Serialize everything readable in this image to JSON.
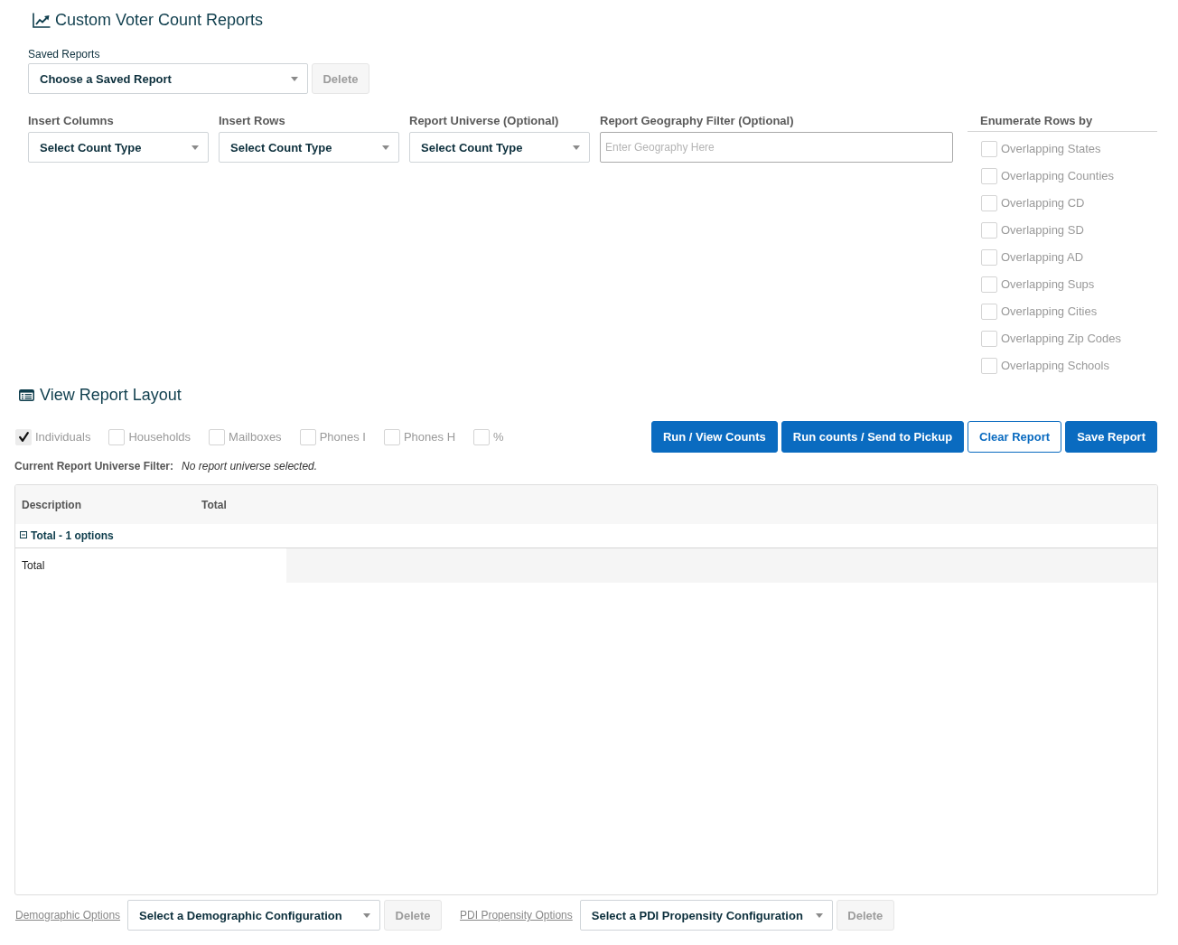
{
  "title": "Custom Voter Count Reports",
  "saved_reports": {
    "label": "Saved Reports",
    "select": "Choose a Saved Report",
    "delete": {
      "label": "Delete",
      "disabled": true
    }
  },
  "filters": [
    {
      "kind": "select",
      "label": "Insert Columns",
      "value": "Select Count Type"
    },
    {
      "kind": "select",
      "label": "Insert Rows",
      "value": "Select Count Type"
    },
    {
      "kind": "select",
      "label": "Report Universe (Optional)",
      "value": "Select Count Type"
    },
    {
      "kind": "text",
      "label": "Report Geography Filter (Optional)",
      "placeholder": "Enter Geography Here"
    }
  ],
  "enumerate": {
    "title": "Enumerate Rows by",
    "options": [
      {
        "label": "Overlapping States",
        "checked": false
      },
      {
        "label": "Overlapping Counties",
        "checked": false
      },
      {
        "label": "Overlapping CD",
        "checked": false
      },
      {
        "label": "Overlapping SD",
        "checked": false
      },
      {
        "label": "Overlapping AD",
        "checked": false
      },
      {
        "label": "Overlapping Sups",
        "checked": false
      },
      {
        "label": "Overlapping Cities",
        "checked": false
      },
      {
        "label": "Overlapping Zip Codes",
        "checked": false
      },
      {
        "label": "Overlapping Schools",
        "checked": false
      }
    ]
  },
  "layout": {
    "title": "View Report Layout",
    "count_types": [
      {
        "label": "Individuals",
        "checked": true
      },
      {
        "label": "Households",
        "checked": false
      },
      {
        "label": "Mailboxes",
        "checked": false
      },
      {
        "label": "Phones I",
        "checked": false
      },
      {
        "label": "Phones H",
        "checked": false
      },
      {
        "label": "%",
        "checked": false
      }
    ],
    "buttons": [
      {
        "kind": "primary",
        "label": "Run / View Counts"
      },
      {
        "kind": "primary",
        "label": "Run counts / Send to Pickup"
      },
      {
        "kind": "outline",
        "label": "Clear Report"
      },
      {
        "kind": "primary",
        "label": "Save Report"
      }
    ],
    "universe_filter": {
      "label": "Current Report Universe Filter:",
      "value": "No report universe selected."
    }
  },
  "table": {
    "columns": [
      "Description",
      "Total"
    ],
    "groups": [
      {
        "label": "Total - 1 options",
        "expanded": true,
        "rows": [
          {
            "label": "Total"
          }
        ]
      }
    ]
  },
  "options_bar": [
    {
      "link": "Demographic Options",
      "select": "Select a Demographic Configuration",
      "delete": {
        "label": "Delete",
        "disabled": true
      }
    },
    {
      "link": "PDI Propensity Options",
      "select": "Select a PDI Propensity Configuration",
      "delete": {
        "label": "Delete",
        "disabled": true
      }
    }
  ]
}
